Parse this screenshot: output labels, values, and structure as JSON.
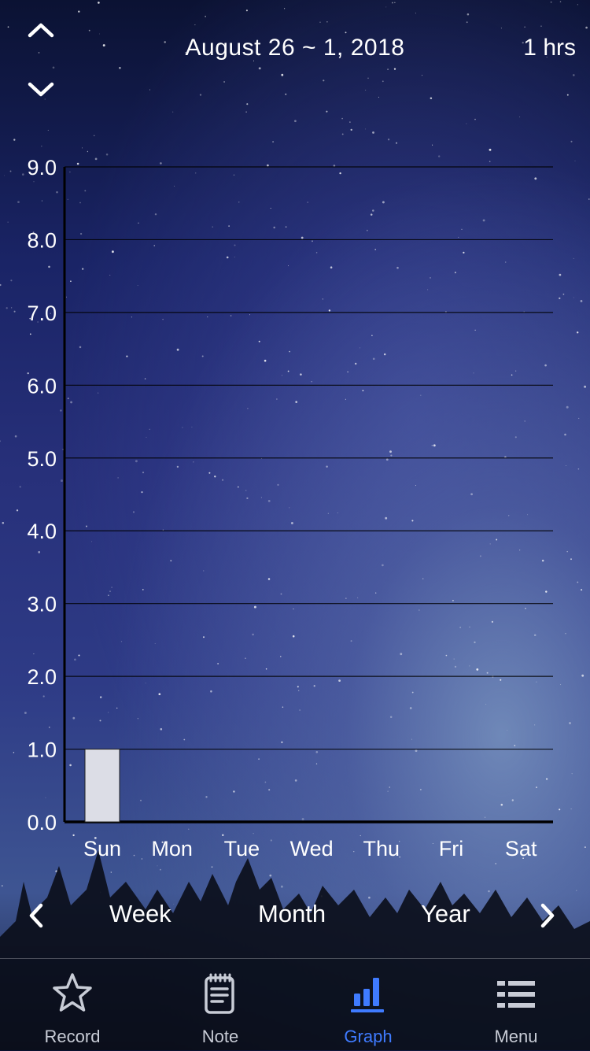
{
  "header": {
    "period": "August 26 ~ 1, 2018",
    "total": "1 hrs"
  },
  "chart_data": {
    "type": "bar",
    "categories": [
      "Sun",
      "Mon",
      "Tue",
      "Wed",
      "Thu",
      "Fri",
      "Sat"
    ],
    "values": [
      1.0,
      0,
      0,
      0,
      0,
      0,
      0
    ],
    "y_ticks": [
      "0.0",
      "1.0",
      "2.0",
      "3.0",
      "4.0",
      "5.0",
      "6.0",
      "7.0",
      "8.0",
      "9.0"
    ],
    "ylim": [
      0,
      9
    ],
    "grid": true,
    "bar_color": "#dcdde6"
  },
  "range_selector": {
    "options": [
      "Week",
      "Month",
      "Year"
    ]
  },
  "tabbar": {
    "items": [
      {
        "label": "Record",
        "icon": "star-icon",
        "active": false
      },
      {
        "label": "Note",
        "icon": "notepad-icon",
        "active": false
      },
      {
        "label": "Graph",
        "icon": "bar-chart-icon",
        "active": true
      },
      {
        "label": "Menu",
        "icon": "list-icon",
        "active": false
      }
    ],
    "active_color": "#3f7bff",
    "inactive_color": "#c8ccd6"
  }
}
